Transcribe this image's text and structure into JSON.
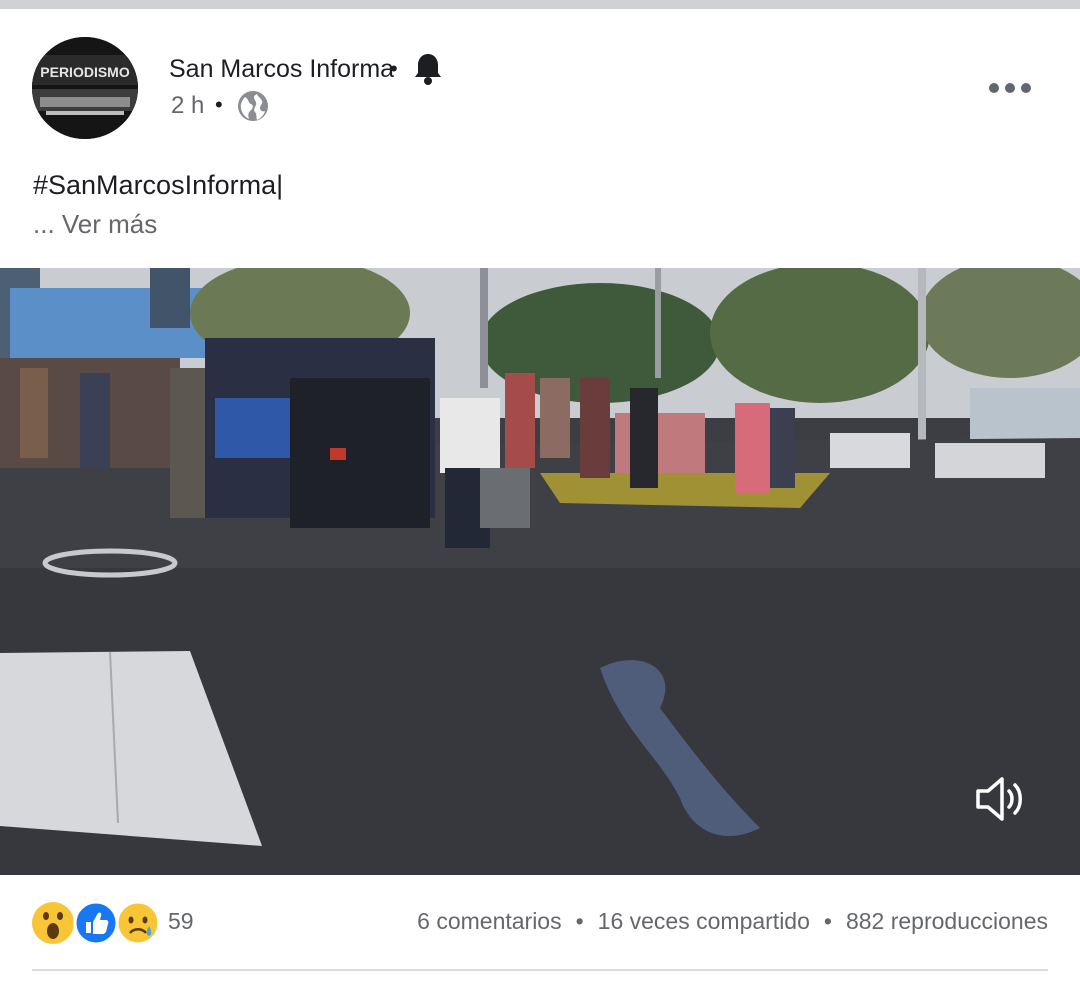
{
  "post": {
    "page_name": "San Marcos Informa",
    "separator": "•",
    "time": "2 h",
    "icons": {
      "notify": "bell-icon",
      "audience": "globe-icon",
      "options": "more-options-icon"
    },
    "text": "#SanMarcosInforma|",
    "see_more": "... Ver más",
    "avatar_text": "PERIODISMO"
  },
  "video": {
    "volume_icon": "volume-icon"
  },
  "footer": {
    "reactions": [
      "wow-reaction",
      "like-reaction",
      "sad-reaction"
    ],
    "reaction_count": "59",
    "comments": "6 comentarios",
    "shares": "16 veces compartido",
    "views": "882 reproducciones",
    "separator": "•"
  },
  "colors": {
    "text": "#1c1e21",
    "secondary": "#65676b",
    "like_blue": "#1877f2",
    "divider": "#dadde1"
  }
}
